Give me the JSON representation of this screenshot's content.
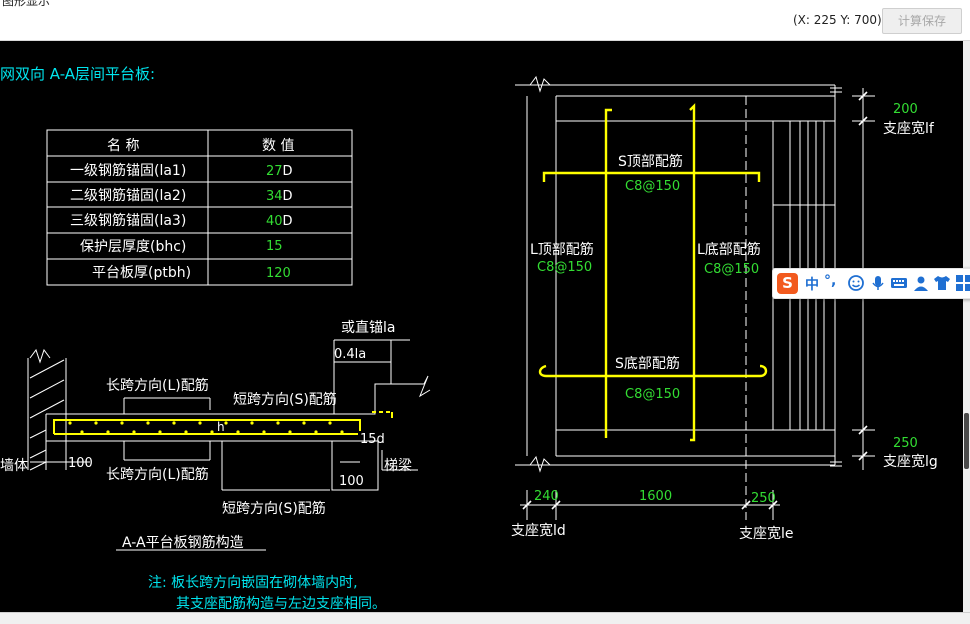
{
  "window": {
    "title": "图形显示"
  },
  "toolbar": {
    "coord_readout": "(X: 225 Y: 700)",
    "calc_save_label": "计算保存"
  },
  "drawing": {
    "heading": "网双向 A-A层间平台板:",
    "table": {
      "header_name": "名 称",
      "header_value": "数 值",
      "rows": [
        {
          "name": "一级钢筋锚固(la1)",
          "value": "27",
          "unit": "D"
        },
        {
          "name": "二级钢筋锚固(la2)",
          "value": "34",
          "unit": "D"
        },
        {
          "name": "三级钢筋锚固(la3)",
          "value": "40",
          "unit": "D"
        },
        {
          "name": "保护层厚度(bhc)",
          "value": "15",
          "unit": ""
        },
        {
          "name": "平台板厚(ptbh)",
          "value": "120",
          "unit": ""
        }
      ]
    },
    "section": {
      "straight_anchor": "或直锚la",
      "factor_04la": "0.4la",
      "long_dir_top": "长跨方向(L)配筋",
      "short_dir_top": "短跨方向(S)配筋",
      "h_label": "h",
      "d15": "15d",
      "wall": "墙体",
      "d100_left": "100",
      "long_dir_bottom": "长跨方向(L)配筋",
      "d100_right": "100",
      "stair_beam": "梯梁",
      "short_dir_bottom": "短跨方向(S)配筋",
      "title": "A-A平台板钢筋构造"
    },
    "note": {
      "line1": "注: 板长跨方向嵌固在砌体墙内时,",
      "line2": "其支座配筋构造与左边支座相同。"
    },
    "plan": {
      "s_top": "S顶部配筋",
      "s_top_spec": "C8@150",
      "l_top": "L顶部配筋",
      "l_top_spec": "C8@150",
      "l_bottom": "L底部配筋",
      "l_bottom_spec": "C8@150",
      "s_bottom": "S底部配筋",
      "s_bottom_spec": "C8@150",
      "dim_top": "200",
      "support_lf": "支座宽lf",
      "dim_bottom": "250",
      "support_lg": "支座宽lg",
      "dim_240": "240",
      "dim_1600": "1600",
      "dim_250": "250",
      "support_ld": "支座宽ld",
      "support_le": "支座宽le"
    }
  },
  "ime": {
    "logo": "S",
    "mode": "中",
    "punct": "°,"
  },
  "colors": {
    "cyan": "#00e5ee",
    "white": "#ffffff",
    "green": "#33dd33",
    "yellow": "#ffff00",
    "background": "#000000"
  }
}
